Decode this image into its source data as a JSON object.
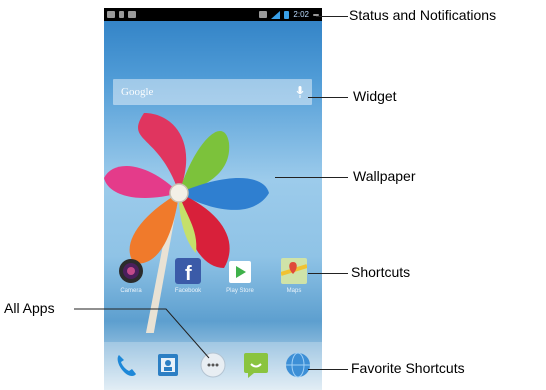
{
  "status_bar": {
    "time": "2:02"
  },
  "widget": {
    "search_text": "Google"
  },
  "apps": [
    {
      "label": "Camera",
      "icon": "camera-icon"
    },
    {
      "label": "Facebook",
      "icon": "facebook-icon"
    },
    {
      "label": "Play Store",
      "icon": "play-store-icon"
    },
    {
      "label": "Maps",
      "icon": "maps-icon"
    }
  ],
  "dock": [
    {
      "icon": "phone-icon"
    },
    {
      "icon": "contacts-icon"
    },
    {
      "icon": "all-apps-icon"
    },
    {
      "icon": "messaging-icon"
    },
    {
      "icon": "browser-icon"
    }
  ],
  "callouts": {
    "status": "Status and Notifications",
    "widget": "Widget",
    "wallpaper": "Wallpaper",
    "shortcuts": "Shortcuts",
    "all_apps": "All Apps",
    "favorites": "Favorite Shortcuts"
  },
  "colors": {
    "status_bar_bg": "#000000",
    "time_color": "#bcdcff",
    "sky_top": "#2e7fc4",
    "sky_mid": "#9ccbeb"
  }
}
